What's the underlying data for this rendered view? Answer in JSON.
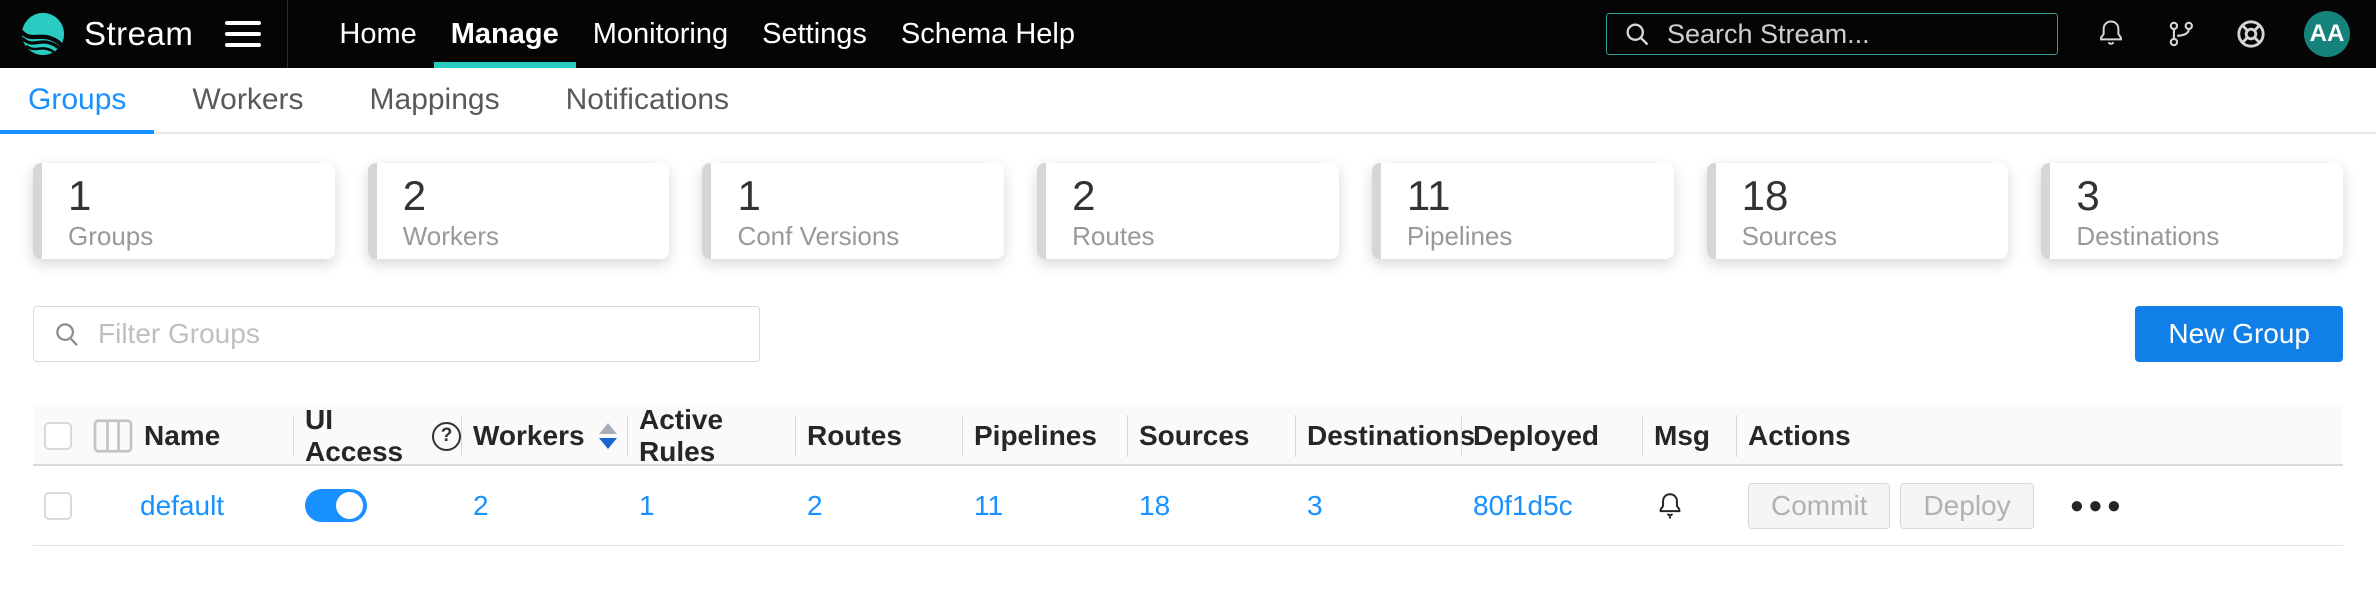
{
  "navbar": {
    "brand": "Stream",
    "items": [
      {
        "label": "Home"
      },
      {
        "label": "Manage"
      },
      {
        "label": "Monitoring"
      },
      {
        "label": "Settings"
      },
      {
        "label": "Schema Help"
      }
    ],
    "active_item": "Manage",
    "search_placeholder": "Search Stream...",
    "avatar_initials": "AA"
  },
  "tabs": [
    {
      "label": "Groups"
    },
    {
      "label": "Workers"
    },
    {
      "label": "Mappings"
    },
    {
      "label": "Notifications"
    }
  ],
  "active_tab": "Groups",
  "stats": [
    {
      "value": "1",
      "label": "Groups"
    },
    {
      "value": "2",
      "label": "Workers"
    },
    {
      "value": "1",
      "label": "Conf Versions"
    },
    {
      "value": "2",
      "label": "Routes"
    },
    {
      "value": "11",
      "label": "Pipelines"
    },
    {
      "value": "18",
      "label": "Sources"
    },
    {
      "value": "3",
      "label": "Destinations"
    }
  ],
  "toolbar": {
    "filter_placeholder": "Filter Groups",
    "new_group_label": "New Group"
  },
  "table": {
    "headers": {
      "name": "Name",
      "ui_access": "UI Access",
      "workers": "Workers",
      "active_rules": "Active Rules",
      "routes": "Routes",
      "pipelines": "Pipelines",
      "sources": "Sources",
      "destinations": "Destinations",
      "deployed": "Deployed",
      "msg": "Msg",
      "actions": "Actions"
    },
    "sort": {
      "column": "Workers",
      "direction": "desc"
    },
    "row": {
      "name": "default",
      "ui_access_on": true,
      "workers": "2",
      "active_rules": "1",
      "routes": "2",
      "pipelines": "11",
      "sources": "18",
      "destinations": "3",
      "deployed": "80f1d5c",
      "commit_label": "Commit",
      "deploy_label": "Deploy"
    }
  },
  "colors": {
    "teal": "#2accc2",
    "link_blue": "#1890ff",
    "button_blue": "#107fe8",
    "header_bg": "#fafafa",
    "navbar_bg": "#050505"
  }
}
